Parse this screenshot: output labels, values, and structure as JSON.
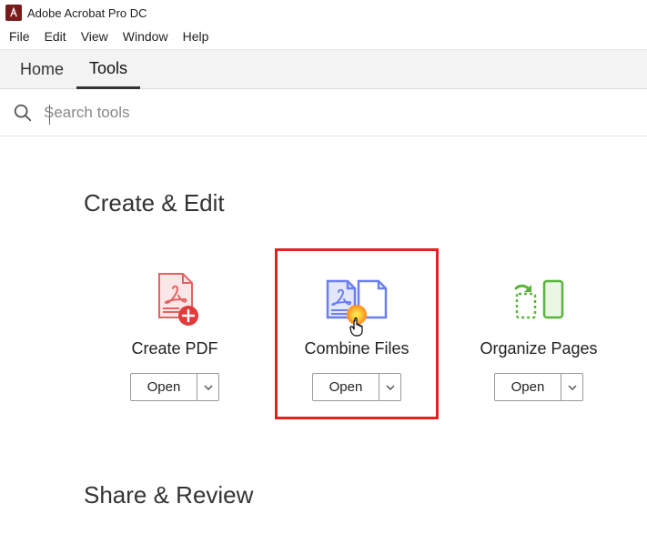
{
  "app": {
    "title": "Adobe Acrobat Pro DC"
  },
  "menu": {
    "file": "File",
    "edit": "Edit",
    "view": "View",
    "window": "Window",
    "help": "Help"
  },
  "tabs": {
    "home": "Home",
    "tools": "Tools"
  },
  "search": {
    "placeholder": "Search tools"
  },
  "sections": {
    "createEdit": {
      "title": "Create & Edit",
      "tools": {
        "createPdf": {
          "name": "Create PDF",
          "button": "Open"
        },
        "combineFiles": {
          "name": "Combine Files",
          "button": "Open"
        },
        "organizePages": {
          "name": "Organize Pages",
          "button": "Open"
        }
      }
    },
    "shareReview": {
      "title": "Share & Review"
    }
  }
}
